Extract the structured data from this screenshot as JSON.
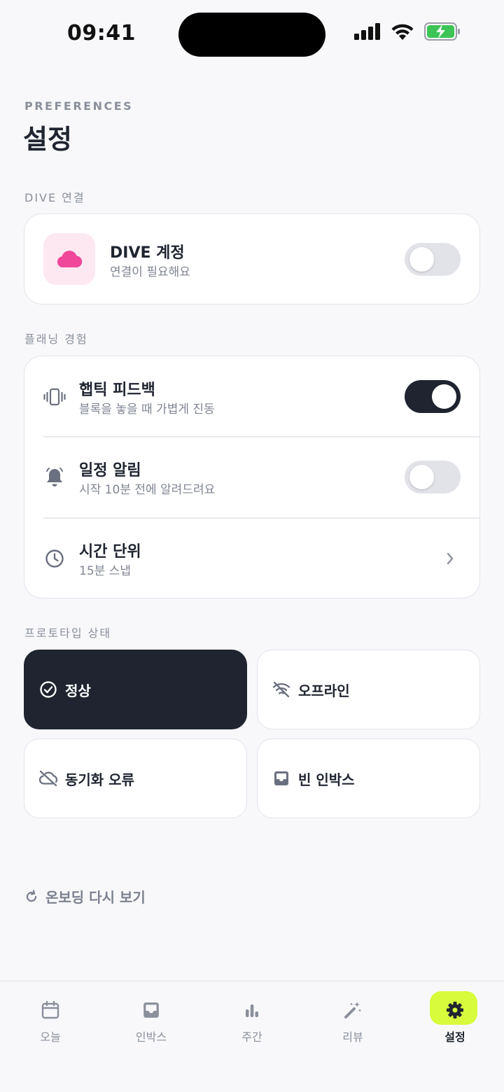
{
  "status_bar": {
    "time": "09:41"
  },
  "header": {
    "eyebrow": "PREFERENCES",
    "title": "설정"
  },
  "dive_section": {
    "label": "DIVE 연결",
    "title": "DIVE 계정",
    "subtitle": "연결이 필요해요",
    "toggle_on": false,
    "icon": "cloud-icon",
    "accent_color": "#f0479a"
  },
  "planning_section": {
    "label": "플래닝 경험",
    "rows": [
      {
        "icon": "vibration-icon",
        "title": "햅틱 피드백",
        "subtitle": "블록을 놓을 때 가볍게 진동",
        "control": "toggle",
        "toggle_on": true
      },
      {
        "icon": "bell-icon",
        "title": "일정 알림",
        "subtitle": "시작 10분 전에 알려드려요",
        "control": "toggle",
        "toggle_on": false
      },
      {
        "icon": "clock-icon",
        "title": "시간 단위",
        "subtitle": "15분 스냅",
        "control": "chevron"
      }
    ]
  },
  "prototype_section": {
    "label": "프로토타입 상태",
    "tiles": [
      {
        "icon": "check-circle-icon",
        "label": "정상",
        "active": true
      },
      {
        "icon": "wifi-off-icon",
        "label": "오프라인",
        "active": false
      },
      {
        "icon": "cloud-off-icon",
        "label": "동기화 오류",
        "active": false
      },
      {
        "icon": "inbox-icon",
        "label": "빈 인박스",
        "active": false
      }
    ]
  },
  "replay_onboarding": {
    "icon": "refresh-icon",
    "label": "온보딩 다시 보기"
  },
  "tabbar": {
    "active_color": "#d8fb3c",
    "tabs": [
      {
        "icon": "calendar-icon",
        "label": "오늘",
        "active": false
      },
      {
        "icon": "inbox-icon",
        "label": "인박스",
        "active": false
      },
      {
        "icon": "bar-chart-icon",
        "label": "주간",
        "active": false
      },
      {
        "icon": "magic-wand-icon",
        "label": "리뷰",
        "active": false
      },
      {
        "icon": "gear-icon",
        "label": "설정",
        "active": true
      }
    ]
  }
}
